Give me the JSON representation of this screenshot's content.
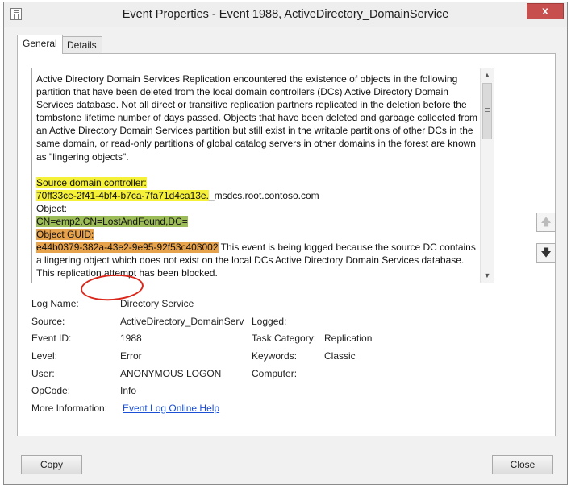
{
  "window": {
    "title": "Event Properties - Event 1988, ActiveDirectory_DomainService",
    "close_label": "x"
  },
  "tabs": [
    {
      "label": "General",
      "active": true
    },
    {
      "label": "Details",
      "active": false
    }
  ],
  "description": {
    "intro": "Active Directory Domain Services Replication encountered the existence of objects in the following partition that have been deleted from the local domain controllers (DCs) Active Directory Domain Services database.  Not all direct or transitive replication partners replicated in the deletion before the tombstone lifetime number of days passed.  Objects that have been deleted and garbage collected from an Active Directory Domain Services partition but still exist in the writable partitions of other DCs in the same domain, or read-only partitions of global catalog servers in other domains in the forest are known as \"lingering objects\".",
    "source_dc_label": "Source domain controller:",
    "source_dc_guid": "70ff33ce-2f41-4bf4-b7ca-7fa71d4ca13e.",
    "source_dc_suffix": "_msdcs.root.contoso.com",
    "object_label": "Object:",
    "object_value": "CN=emp2,CN=LostAndFound,DC=",
    "guid_label": "Object GUID:",
    "guid_value": "e44b0379-382a-43e2-9e95-92f53c403002",
    "guid_trailing": " This event is being logged because the source DC contains a lingering object which does not exist on the local DCs Active Directory Domain Services database.  This replication attempt has been blocked."
  },
  "details": {
    "log_name_label": "Log Name:",
    "log_name_value": "Directory Service",
    "source_label": "Source:",
    "source_value": "ActiveDirectory_DomainServ",
    "logged_label": "Logged:",
    "logged_value": "",
    "event_id_label": "Event ID:",
    "event_id_value": "1988",
    "task_category_label": "Task Category:",
    "task_category_value": "Replication",
    "level_label": "Level:",
    "level_value": "Error",
    "keywords_label": "Keywords:",
    "keywords_value": "Classic",
    "user_label": "User:",
    "user_value": "ANONYMOUS LOGON",
    "computer_label": "Computer:",
    "computer_value": "",
    "opcode_label": "OpCode:",
    "opcode_value": "Info",
    "more_info_label": "More Information:",
    "more_info_link": "Event Log Online Help"
  },
  "buttons": {
    "copy": "Copy",
    "close": "Close"
  },
  "icons": {
    "app": "event-properties-icon",
    "scroll_up": "chevron-up-icon",
    "scroll_down": "chevron-down-icon",
    "prev_event": "arrow-up-icon",
    "next_event": "arrow-down-icon"
  },
  "colors": {
    "highlight_yellow": "#f5f038",
    "highlight_green": "#9cbc57",
    "highlight_orange": "#e7a24c",
    "annotation_circle": "#d9271c",
    "close_button": "#c7504f",
    "link": "#1b4fd6"
  }
}
